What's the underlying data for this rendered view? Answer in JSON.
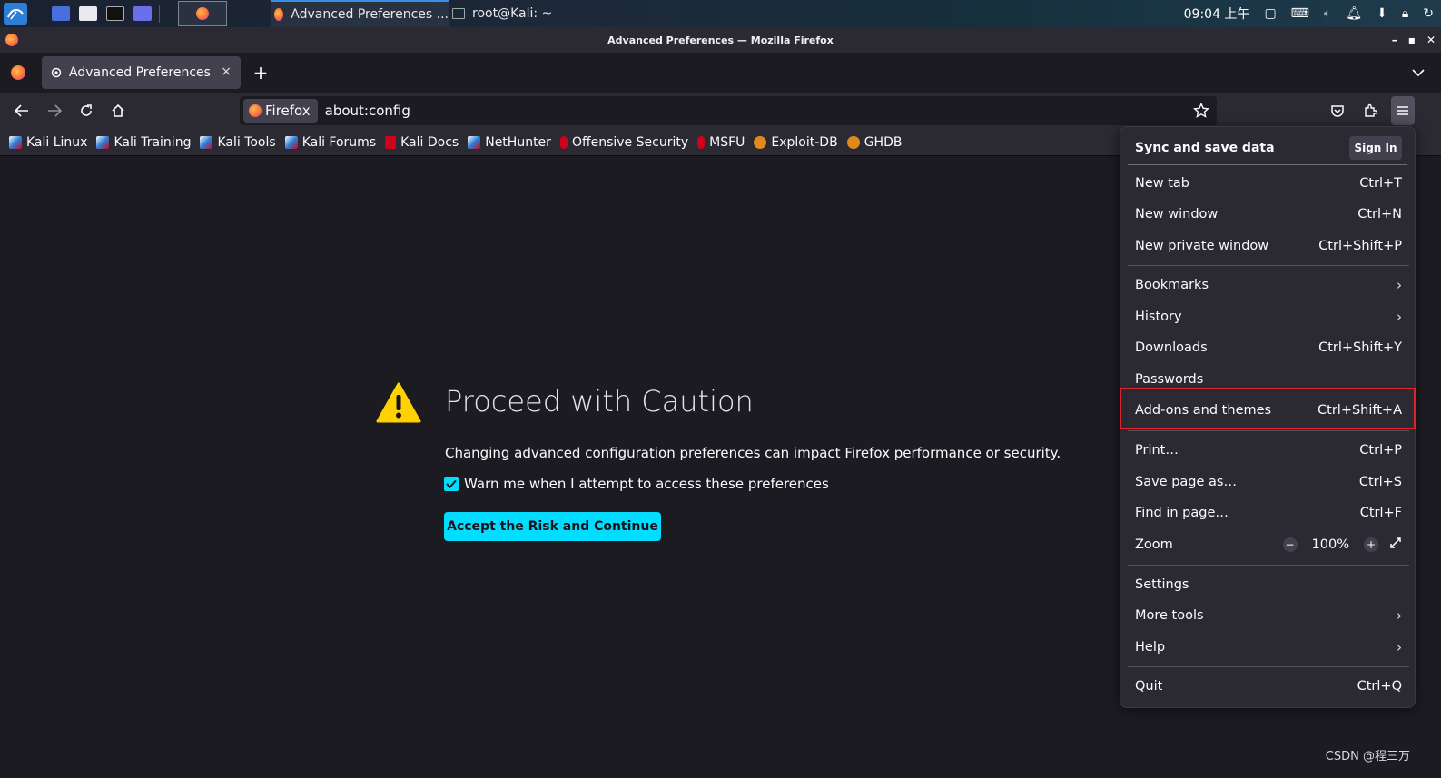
{
  "taskbar": {
    "tasks": {
      "firefox_label": "Advanced Preferences ...",
      "terminal_label": "root@Kali: ~"
    },
    "tray": {
      "time": "09:04 上午"
    }
  },
  "window": {
    "title": "Advanced Preferences — Mozilla Firefox",
    "minimize_label": "–",
    "maximize_label": "▪",
    "close_label": "✕"
  },
  "tabs": {
    "active_title": "Advanced Preferences",
    "close_glyph": "×",
    "new_tab_glyph": "+"
  },
  "urlbar": {
    "identity_label": "Firefox",
    "url": "about:config"
  },
  "bookmarks": [
    {
      "label": "Kali Linux",
      "icon": "kali-icon"
    },
    {
      "label": "Kali Training",
      "icon": "kali-icon"
    },
    {
      "label": "Kali Tools",
      "icon": "kali-icon"
    },
    {
      "label": "Kali Forums",
      "icon": "kali-icon"
    },
    {
      "label": "Kali Docs",
      "icon": "kali-docs-icon"
    },
    {
      "label": "NetHunter",
      "icon": "kali-icon"
    },
    {
      "label": "Offensive Security",
      "icon": "offsec-icon"
    },
    {
      "label": "MSFU",
      "icon": "offsec-icon"
    },
    {
      "label": "Exploit-DB",
      "icon": "exploitdb-icon"
    },
    {
      "label": "GHDB",
      "icon": "ghdb-icon"
    }
  ],
  "page": {
    "title": "Proceed with Caution",
    "description": "Changing advanced configuration preferences can impact Firefox performance or security.",
    "checkbox_label": "Warn me when I attempt to access these preferences",
    "checkbox_checked": true,
    "accept_button": "Accept the Risk and Continue"
  },
  "app_menu": {
    "sync_label": "Sync and save data",
    "sign_in": "Sign In",
    "items": {
      "new_tab": {
        "label": "New tab",
        "shortcut": "Ctrl+T"
      },
      "new_window": {
        "label": "New window",
        "shortcut": "Ctrl+N"
      },
      "new_private": {
        "label": "New private window",
        "shortcut": "Ctrl+Shift+P"
      },
      "bookmarks": {
        "label": "Bookmarks"
      },
      "history": {
        "label": "History"
      },
      "downloads": {
        "label": "Downloads",
        "shortcut": "Ctrl+Shift+Y"
      },
      "passwords": {
        "label": "Passwords"
      },
      "addons": {
        "label": "Add-ons and themes",
        "shortcut": "Ctrl+Shift+A"
      },
      "print": {
        "label": "Print…",
        "shortcut": "Ctrl+P"
      },
      "save_page": {
        "label": "Save page as…",
        "shortcut": "Ctrl+S"
      },
      "find": {
        "label": "Find in page…",
        "shortcut": "Ctrl+F"
      },
      "zoom": {
        "label": "Zoom",
        "value": "100%",
        "minus": "−",
        "plus": "+"
      },
      "settings": {
        "label": "Settings"
      },
      "more_tools": {
        "label": "More tools"
      },
      "help": {
        "label": "Help"
      },
      "quit": {
        "label": "Quit",
        "shortcut": "Ctrl+Q"
      }
    },
    "chevron": "›"
  },
  "watermark": "CSDN @程三万",
  "colors": {
    "accent": "#00ddff",
    "highlight_border": "#e0232b",
    "warning": "#ffd100"
  }
}
